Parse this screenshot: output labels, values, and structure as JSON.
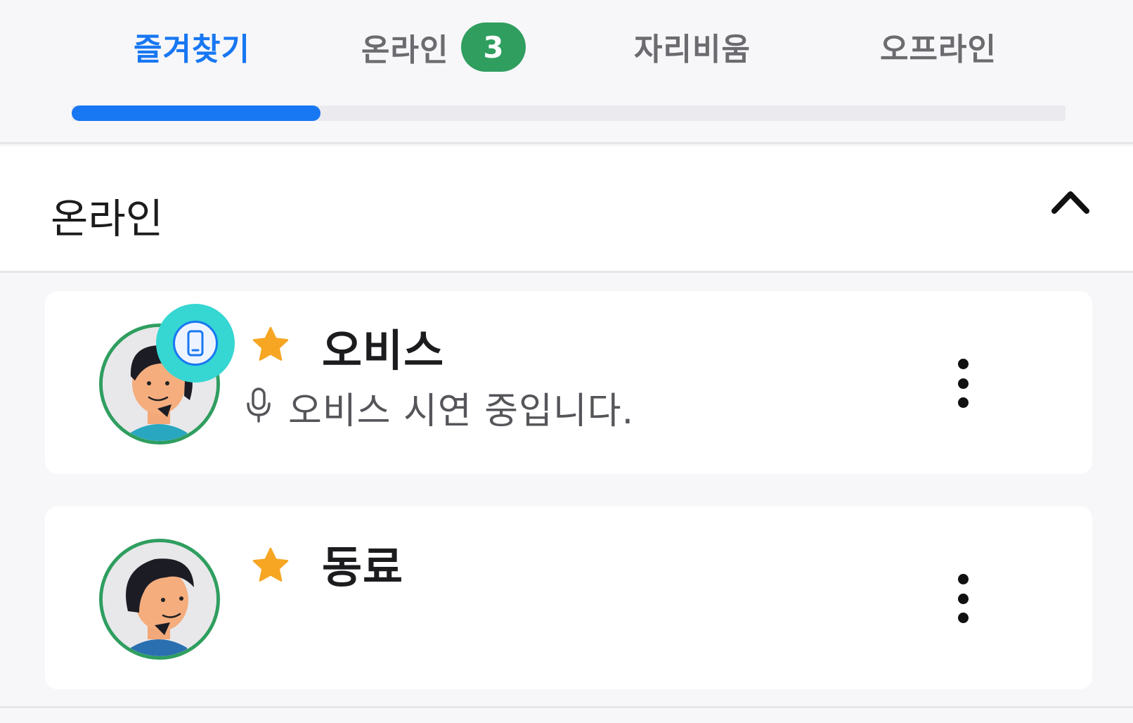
{
  "tabs": [
    {
      "label": "즐겨찾기",
      "active": true
    },
    {
      "label": "온라인",
      "badge": "3"
    },
    {
      "label": "자리비움"
    },
    {
      "label": "오프라인"
    }
  ],
  "tab_indicator": {
    "position": 1,
    "total": 4
  },
  "section": {
    "title": "온라인",
    "collapse_icon": "chevron-up-icon"
  },
  "contacts": [
    {
      "name": "오비스",
      "favorite": true,
      "device_icon": "mobile-icon",
      "status_icon": "microphone-icon",
      "status": "오비스 시연 중입니다."
    },
    {
      "name": "동료",
      "favorite": true
    }
  ],
  "colors": {
    "accent": "#1877f2",
    "online_green": "#2f9e5f",
    "star": "#f6a623",
    "device_badge": "#36d6d2"
  }
}
